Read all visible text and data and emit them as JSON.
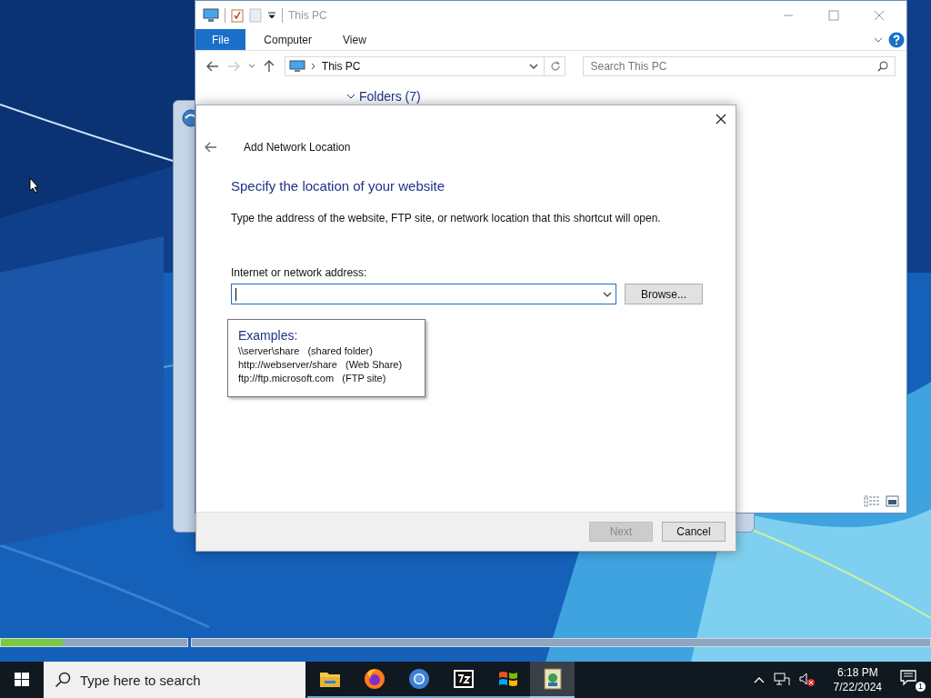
{
  "explorer": {
    "title": "This PC",
    "ribbon_tabs": [
      {
        "label": "File",
        "selected": true
      },
      {
        "label": "Computer",
        "selected": false
      },
      {
        "label": "View",
        "selected": false
      }
    ],
    "address": "This PC",
    "search": {
      "placeholder": "Search This PC"
    },
    "group_header": "Folders (7)"
  },
  "dialog": {
    "title": "Add Network Location",
    "heading": "Specify the location of your website",
    "description": "Type the address of the website, FTP site, or network location that this shortcut will open.",
    "field_label": "Internet or network address:",
    "browse_button": "Browse...",
    "tooltip": {
      "title": "Examples:",
      "lines": [
        "\\\\server\\share   (shared folder)",
        "http://webserver/share   (Web Share)",
        "ftp://ftp.microsoft.com   (FTP site)"
      ]
    },
    "buttons": [
      {
        "label": "Next",
        "disabled": true
      },
      {
        "label": "Cancel",
        "disabled": false
      }
    ]
  },
  "progress": {
    "level": 0.33
  },
  "taskbar": {
    "search": {
      "placeholder": "Type here to search"
    },
    "apps": [
      {
        "kind": "folder",
        "selected": false
      },
      {
        "kind": "firefox",
        "selected": false
      },
      {
        "kind": "chromium",
        "selected": false
      },
      {
        "kind": "archiver",
        "selected": false
      },
      {
        "kind": "windows",
        "selected": false
      },
      {
        "kind": "installer",
        "selected": true
      }
    ],
    "time": "6:18 PM",
    "date": "7/22/2024",
    "notifications": "1"
  }
}
